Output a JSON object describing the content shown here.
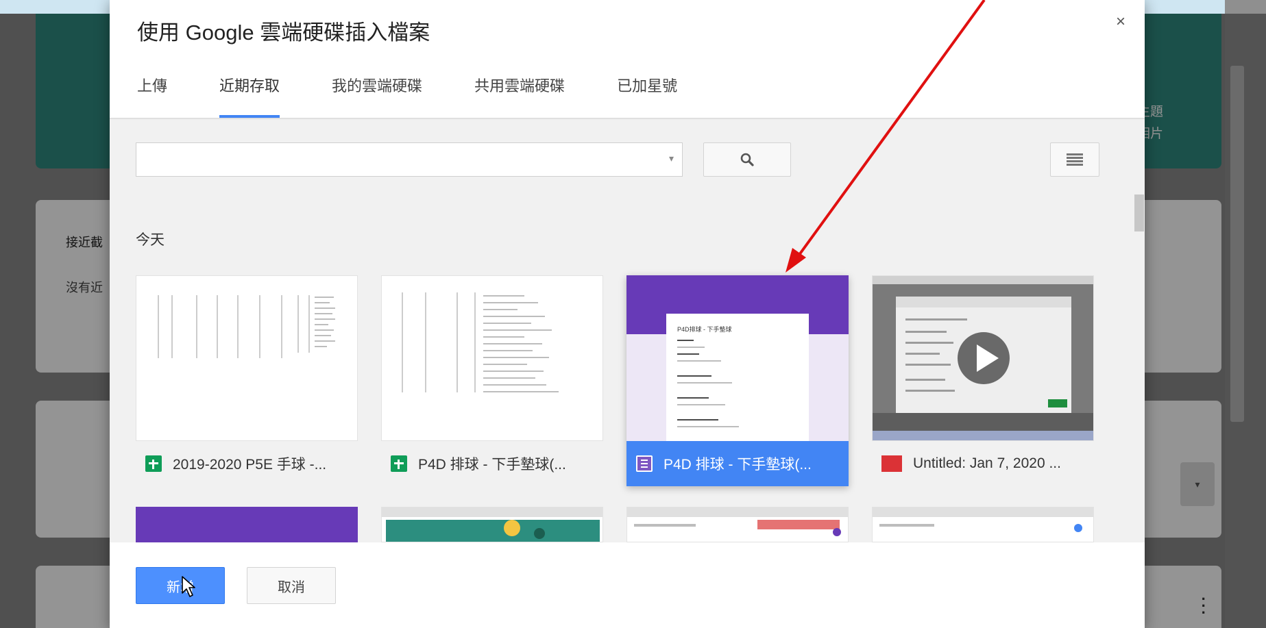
{
  "background": {
    "header_line1": "取主題",
    "header_line2": "傳相片",
    "card_title": "接近截",
    "card_sub": "沒有近",
    "dropdown_icon": "chevron-down-icon",
    "kebab_icon": "kebab-menu-icon"
  },
  "dialog": {
    "title": "使用 Google 雲端硬碟插入檔案",
    "close_label": "×",
    "tabs": [
      {
        "label": "上傳",
        "active": false
      },
      {
        "label": "近期存取",
        "active": true
      },
      {
        "label": "我的雲端硬碟",
        "active": false
      },
      {
        "label": "共用雲端硬碟",
        "active": false
      },
      {
        "label": "已加星號",
        "active": false
      }
    ],
    "search": {
      "value": "",
      "placeholder": ""
    },
    "section_label": "今天",
    "files": [
      {
        "name": "2019-2020 P5E 手球 -...",
        "type": "sheets",
        "selected": false
      },
      {
        "name": "P4D 排球 - 下手墊球(...",
        "type": "sheets",
        "selected": false
      },
      {
        "name": "P4D 排球 - 下手墊球(...",
        "type": "forms",
        "selected": true
      },
      {
        "name": "Untitled: Jan 7, 2020 ...",
        "type": "video",
        "selected": false
      }
    ],
    "form_preview": {
      "title": "P4D排球 - 下手墊球"
    },
    "select_button": "新增",
    "cancel_button": "取消"
  },
  "colors": {
    "accent": "#4285f4",
    "header_teal": "#2f8b80",
    "forms_purple": "#673ab7",
    "sheets_green": "#0f9d58",
    "annotation_red": "#e01010"
  }
}
